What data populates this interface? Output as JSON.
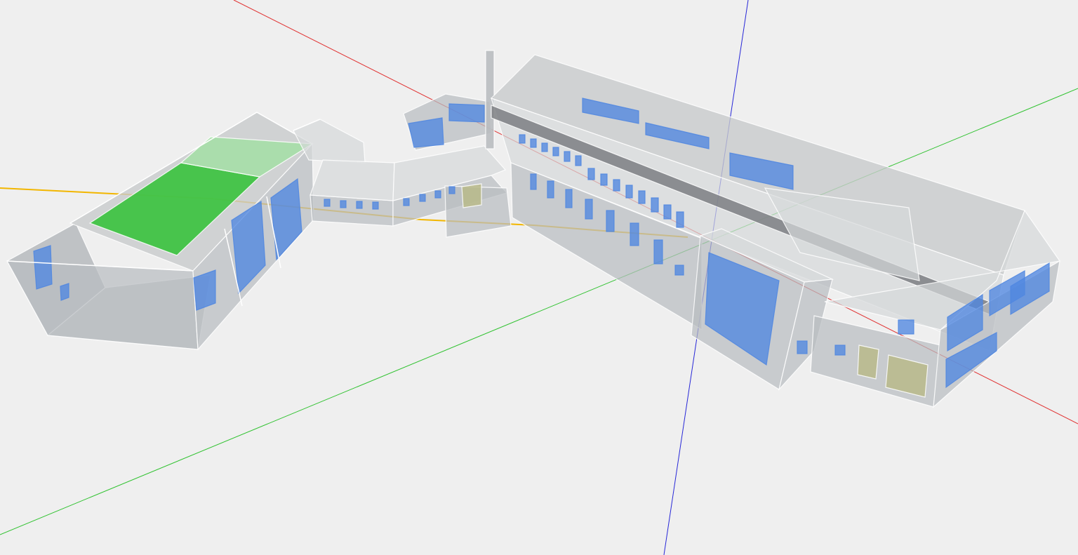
{
  "viewport": {
    "background": "#efefef",
    "axis_colors": {
      "x_axis": "#e03030",
      "y_axis": "#2fc22f",
      "z_axis": "#2727d8",
      "site_reference_line": "#f2b600"
    },
    "material_colors": {
      "wall_glass": "#b9bcc0",
      "wall_glass_light": "#d6d8da",
      "roof": "#c8cacc",
      "edge": "#ffffff",
      "window": "#4f86e0",
      "pv_panel": "#39c23d",
      "pv_panel_light": "#9ee09f",
      "door": "#b8ba8a",
      "dark_band": "#7c7f83"
    },
    "icons": [
      "axis-origin-icon"
    ]
  }
}
